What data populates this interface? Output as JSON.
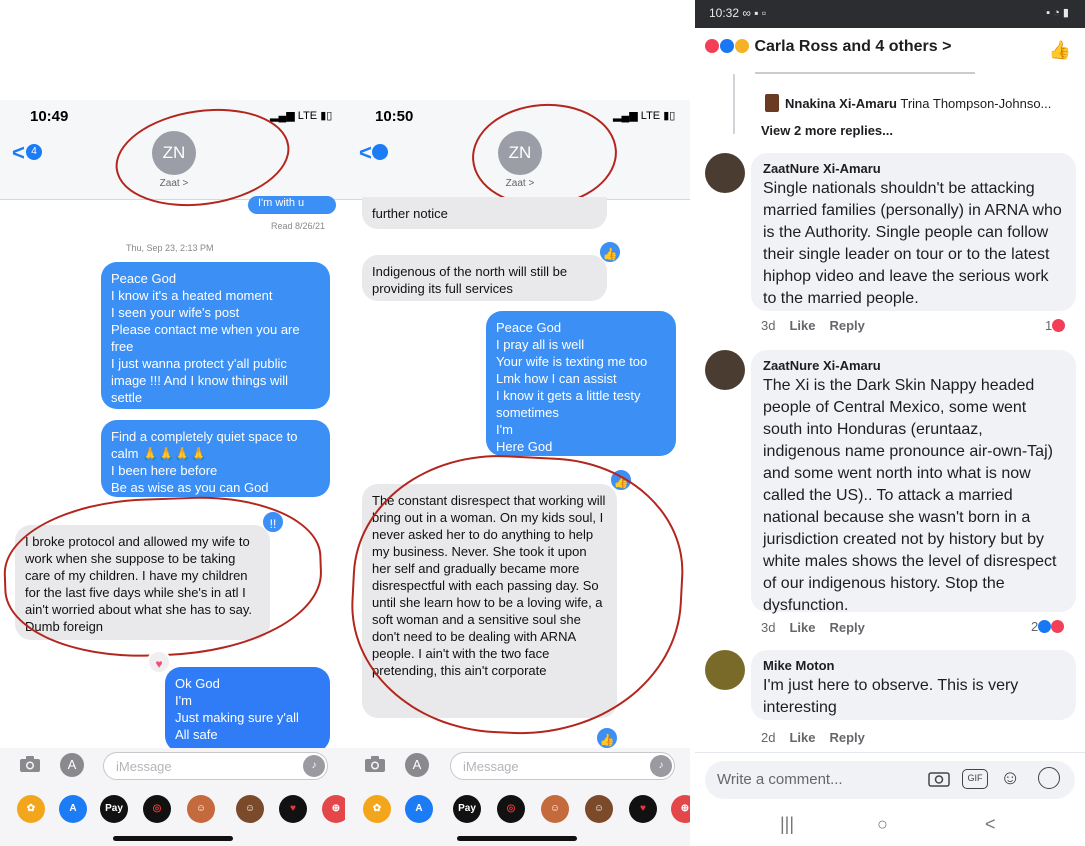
{
  "left": {
    "status_time": "10:49",
    "status_signal": "LTE",
    "back_badge": "4",
    "avatar_initials": "ZN",
    "contact_name": "Zaat >",
    "top_partial": "I'm with u",
    "read_receipt": "Read 8/26/21",
    "timestamp": "Thu, Sep 23, 2:13 PM",
    "msg1": "Peace God\nI know it's a heated moment\nI seen your wife's post\nPlease contact me when you are free\nI just wanna protect y'all public image !!! And I know things will settle",
    "msg2": "Find a completely quiet space to calm 🙏🙏🙏🙏\nI been here before\nBe as wise as you can God",
    "reaction2": "!!",
    "msg3": "I broke protocol and allowed my wife to work when she suppose to be taking care of my children. I have my children for the last five days while she's in atl I ain't worried about what she has to say. Dumb foreign",
    "reaction3": "♥",
    "msg4": "Ok God\nI'm\nJust making sure y'all\nAll safe\n"
  },
  "middle": {
    "status_time": "10:50",
    "status_signal": "LTE",
    "avatar_initials": "ZN",
    "contact_name": "Zaat >",
    "msg0": "further notice",
    "msg1": "Indigenous of the north will still be providing its full services",
    "msg2": "Peace God\nI pray all is well\nYour wife is texting me too\nLmk how I can assist\nI know it gets a little testy sometimes\nI'm\nHere God",
    "msg3": "The constant disrespect that working will bring out in a woman. On my kids soul, I never asked her to do anything to help my business. Never. She took it upon her self and gradually became more disrespectful with each passing day. So until she learn how to be a loving wife, a soft woman and a sensitive soul she don't need to be dealing with ARNA people. I ain't with the two face pretending, this ain't corporate"
  },
  "imessage_placeholder": "iMessage",
  "app_tray": [
    "Photos",
    "App Store",
    "Pay",
    "Activity",
    "Memoji",
    "Memoji 2",
    "Heart",
    "Web"
  ],
  "pay_label": "Pay",
  "fb": {
    "status_time": "10:32",
    "title": "Carla Ross and 4 others",
    "reply_author": "Nnakina Xi-Amaru",
    "reply_preview": "Trina Thompson-Johnso...",
    "view_more": "View 2 more replies...",
    "comments": [
      {
        "name": "ZaatNure Xi-Amaru",
        "text": "Single nationals shouldn't be attacking married families (personally) in ARNA who is the Authority. Single people can follow their single leader on tour or to the latest hiphop video and leave the serious work to the married people.",
        "time": "3d",
        "like": "Like",
        "reply": "Reply",
        "reactions": "1"
      },
      {
        "name": "ZaatNure Xi-Amaru",
        "text": "The Xi is the Dark Skin Nappy headed people of Central Mexico, some went south into Honduras (eruntaaz, indigenous name pronounce air-own-Taj) and some went north into what is now called the US).. To attack a married national because she wasn't born in a jurisdiction created not by history but by white males shows the level of disrespect of our indigenous history. Stop the dysfunction.",
        "time": "3d",
        "like": "Like",
        "reply": "Reply",
        "reactions": "2"
      },
      {
        "name": "Mike Moton",
        "text": "I'm just here to observe. This is very interesting",
        "time": "2d",
        "like": "Like",
        "reply": "Reply",
        "reactions": ""
      }
    ],
    "composer_placeholder": "Write a comment...",
    "gif_label": "GIF",
    "nav": [
      "|||",
      "○",
      "<"
    ]
  }
}
